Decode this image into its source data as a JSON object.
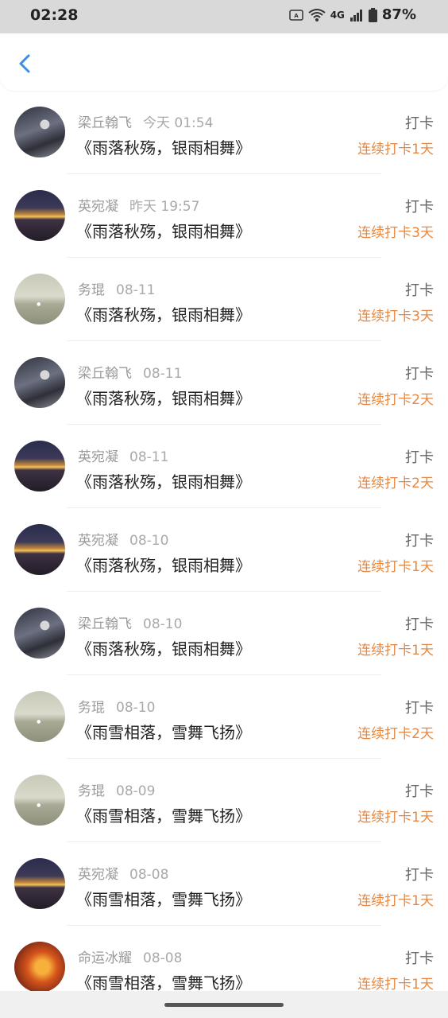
{
  "status_bar": {
    "time": "02:28",
    "network": "4G",
    "battery": "87%",
    "icons": [
      "nfc-icon",
      "wifi-icon",
      "signal-icon",
      "battery-icon"
    ]
  },
  "header": {
    "back_icon": "chevron-left-icon",
    "accent": "#3a8ee6"
  },
  "list": {
    "items": [
      {
        "name": "梁丘翰飞",
        "date": "今天 01:54",
        "title": "《雨落秋殇，银雨相舞》",
        "action": "打卡",
        "streak": "连续打卡1天",
        "avatar": "a"
      },
      {
        "name": "英宛凝",
        "date": "昨天 19:57",
        "title": "《雨落秋殇，银雨相舞》",
        "action": "打卡",
        "streak": "连续打卡3天",
        "avatar": "b"
      },
      {
        "name": "务琨",
        "date": "08-11",
        "title": "《雨落秋殇，银雨相舞》",
        "action": "打卡",
        "streak": "连续打卡3天",
        "avatar": "c"
      },
      {
        "name": "梁丘翰飞",
        "date": "08-11",
        "title": "《雨落秋殇，银雨相舞》",
        "action": "打卡",
        "streak": "连续打卡2天",
        "avatar": "a"
      },
      {
        "name": "英宛凝",
        "date": "08-11",
        "title": "《雨落秋殇，银雨相舞》",
        "action": "打卡",
        "streak": "连续打卡2天",
        "avatar": "b"
      },
      {
        "name": "英宛凝",
        "date": "08-10",
        "title": "《雨落秋殇，银雨相舞》",
        "action": "打卡",
        "streak": "连续打卡1天",
        "avatar": "b"
      },
      {
        "name": "梁丘翰飞",
        "date": "08-10",
        "title": "《雨落秋殇，银雨相舞》",
        "action": "打卡",
        "streak": "连续打卡1天",
        "avatar": "a"
      },
      {
        "name": "务琨",
        "date": "08-10",
        "title": "《雨雪相落，雪舞飞扬》",
        "action": "打卡",
        "streak": "连续打卡2天",
        "avatar": "c"
      },
      {
        "name": "务琨",
        "date": "08-09",
        "title": "《雨雪相落，雪舞飞扬》",
        "action": "打卡",
        "streak": "连续打卡1天",
        "avatar": "c"
      },
      {
        "name": "英宛凝",
        "date": "08-08",
        "title": "《雨雪相落，雪舞飞扬》",
        "action": "打卡",
        "streak": "连续打卡1天",
        "avatar": "b"
      },
      {
        "name": "命运冰耀",
        "date": "08-08",
        "title": "《雨雪相落，雪舞飞扬》",
        "action": "打卡",
        "streak": "连续打卡1天",
        "avatar": "d"
      }
    ]
  },
  "colors": {
    "streak": "#e8873f",
    "name": "#9a9a9a",
    "title": "#222222"
  }
}
